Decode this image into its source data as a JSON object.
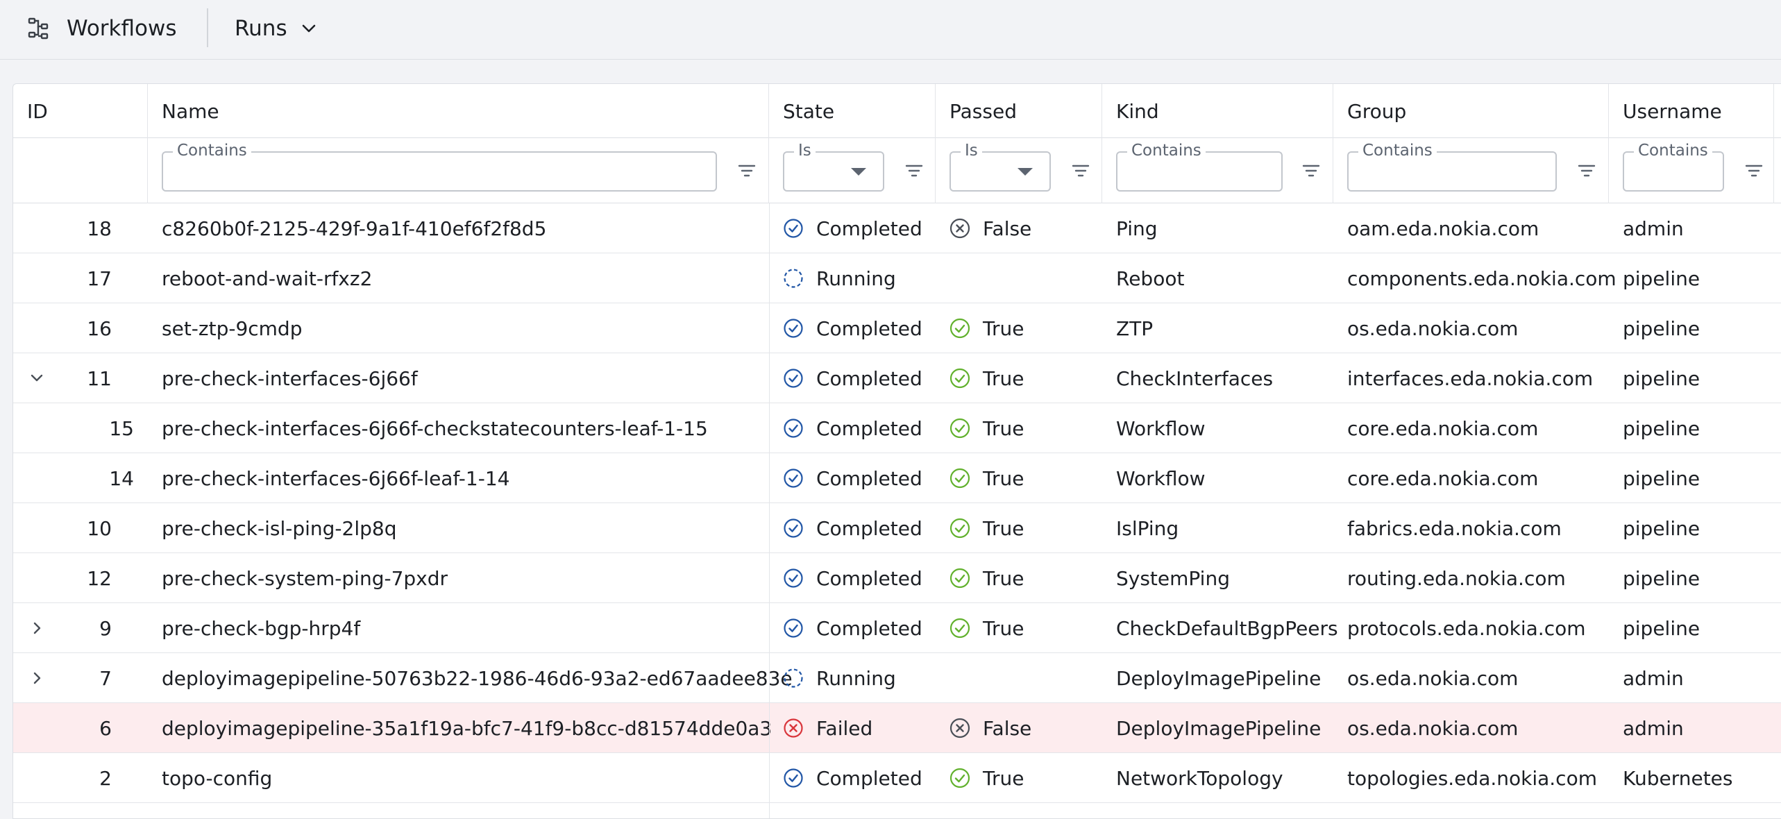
{
  "topbar": {
    "icon": "workflow-icon",
    "title": "Workflows",
    "menu_label": "Runs",
    "menu_icon": "chevron-down-icon"
  },
  "table": {
    "columns": [
      {
        "key": "id",
        "label": "ID"
      },
      {
        "key": "name",
        "label": "Name"
      },
      {
        "key": "state",
        "label": "State"
      },
      {
        "key": "passed",
        "label": "Passed"
      },
      {
        "key": "kind",
        "label": "Kind"
      },
      {
        "key": "group",
        "label": "Group"
      },
      {
        "key": "username",
        "label": "Username"
      }
    ],
    "filters": {
      "name": {
        "legend": "Contains",
        "value": ""
      },
      "state": {
        "legend": "Is",
        "value": ""
      },
      "passed": {
        "legend": "Is",
        "value": ""
      },
      "kind": {
        "legend": "Contains",
        "value": ""
      },
      "group": {
        "legend": "Contains",
        "value": ""
      },
      "username": {
        "legend": "Contains",
        "value": ""
      }
    },
    "rows": [
      {
        "id": "18",
        "name": "c8260b0f-2125-429f-9a1f-410ef6f2f8d5",
        "state": "Completed",
        "passed": "False",
        "kind": "Ping",
        "group": "oam.eda.nokia.com",
        "username": "admin",
        "expander": "",
        "indent": 0,
        "highlight": false
      },
      {
        "id": "17",
        "name": "reboot-and-wait-rfxz2",
        "state": "Running",
        "passed": "",
        "kind": "Reboot",
        "group": "components.eda.nokia.com",
        "username": "pipeline",
        "expander": "",
        "indent": 0,
        "highlight": false
      },
      {
        "id": "16",
        "name": "set-ztp-9cmdp",
        "state": "Completed",
        "passed": "True",
        "kind": "ZTP",
        "group": "os.eda.nokia.com",
        "username": "pipeline",
        "expander": "",
        "indent": 0,
        "highlight": false
      },
      {
        "id": "11",
        "name": "pre-check-interfaces-6j66f",
        "state": "Completed",
        "passed": "True",
        "kind": "CheckInterfaces",
        "group": "interfaces.eda.nokia.com",
        "username": "pipeline",
        "expander": "expanded",
        "indent": 0,
        "highlight": false
      },
      {
        "id": "15",
        "name": "pre-check-interfaces-6j66f-checkstatecounters-leaf-1-15",
        "state": "Completed",
        "passed": "True",
        "kind": "Workflow",
        "group": "core.eda.nokia.com",
        "username": "pipeline",
        "expander": "",
        "indent": 1,
        "highlight": false
      },
      {
        "id": "14",
        "name": "pre-check-interfaces-6j66f-leaf-1-14",
        "state": "Completed",
        "passed": "True",
        "kind": "Workflow",
        "group": "core.eda.nokia.com",
        "username": "pipeline",
        "expander": "",
        "indent": 1,
        "highlight": false
      },
      {
        "id": "10",
        "name": "pre-check-isl-ping-2lp8q",
        "state": "Completed",
        "passed": "True",
        "kind": "IslPing",
        "group": "fabrics.eda.nokia.com",
        "username": "pipeline",
        "expander": "",
        "indent": 0,
        "highlight": false
      },
      {
        "id": "12",
        "name": "pre-check-system-ping-7pxdr",
        "state": "Completed",
        "passed": "True",
        "kind": "SystemPing",
        "group": "routing.eda.nokia.com",
        "username": "pipeline",
        "expander": "",
        "indent": 0,
        "highlight": false
      },
      {
        "id": "9",
        "name": "pre-check-bgp-hrp4f",
        "state": "Completed",
        "passed": "True",
        "kind": "CheckDefaultBgpPeers",
        "group": "protocols.eda.nokia.com",
        "username": "pipeline",
        "expander": "collapsed",
        "indent": 0,
        "highlight": false
      },
      {
        "id": "7",
        "name": "deployimagepipeline-50763b22-1986-46d6-93a2-ed67aadee83e",
        "state": "Running",
        "passed": "",
        "kind": "DeployImagePipeline",
        "group": "os.eda.nokia.com",
        "username": "admin",
        "expander": "collapsed",
        "indent": 0,
        "highlight": false
      },
      {
        "id": "6",
        "name": "deployimagepipeline-35a1f19a-bfc7-41f9-b8cc-d81574dde0a3",
        "state": "Failed",
        "passed": "False",
        "kind": "DeployImagePipeline",
        "group": "os.eda.nokia.com",
        "username": "admin",
        "expander": "",
        "indent": 0,
        "highlight": true
      },
      {
        "id": "2",
        "name": "topo-config",
        "state": "Completed",
        "passed": "True",
        "kind": "NetworkTopology",
        "group": "topologies.eda.nokia.com",
        "username": "Kubernetes",
        "expander": "",
        "indent": 0,
        "highlight": false
      }
    ]
  },
  "icons": {
    "Completed": "check-circle-icon",
    "Running": "running-dashed-circle-icon",
    "Failed": "error-circle-icon",
    "True": "check-circle-icon",
    "False": "x-circle-icon",
    "filter": "filter-icon",
    "expanded": "chevron-down-icon",
    "collapsed": "chevron-right-icon"
  },
  "colors": {
    "completed": "#2156a6",
    "running": "#2156a6",
    "failed": "#d9353b",
    "true": "#62b12e",
    "false": "#4a4f57",
    "failed_row_bg": "#fdecee"
  }
}
